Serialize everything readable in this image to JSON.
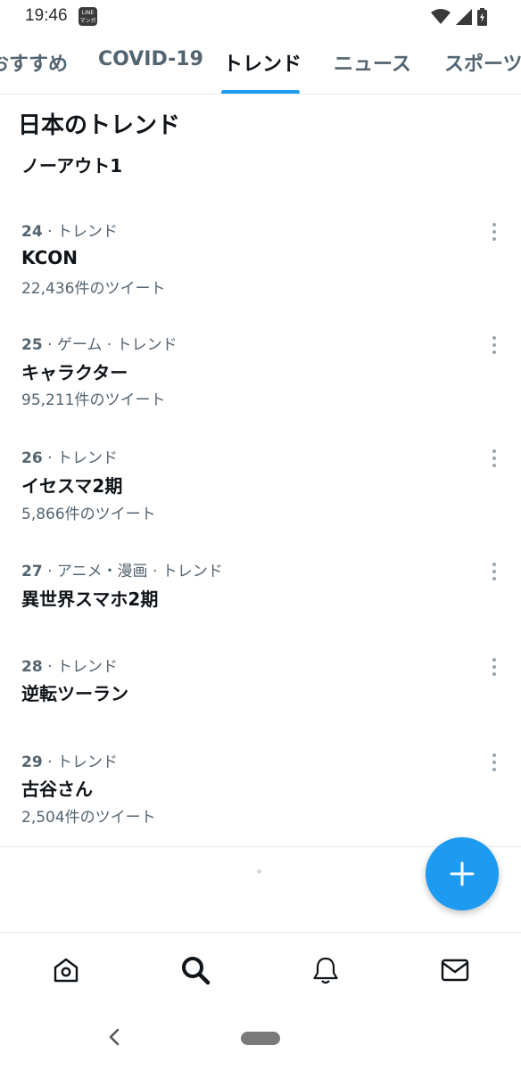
{
  "status_bar": {
    "time": "19:46",
    "app_badge": "LINE\nマンガ",
    "icons": [
      "wifi-icon",
      "cell-signal-icon",
      "battery-charging-icon"
    ]
  },
  "tabs": [
    {
      "label": "おすすめ",
      "active": false
    },
    {
      "label": "COVID-19",
      "active": false
    },
    {
      "label": "トレンド",
      "active": true
    },
    {
      "label": "ニュース",
      "active": false
    },
    {
      "label": "スポーツ",
      "active": false
    }
  ],
  "section_title": "日本のトレンド",
  "first_trend": "ノーアウト1",
  "trends": [
    {
      "rank": "24",
      "category": "· トレンド",
      "name": "KCON",
      "count": "22,436件のツイート"
    },
    {
      "rank": "25",
      "category": "· ゲーム · トレンド",
      "name": "キャラクター",
      "count": "95,211件のツイート"
    },
    {
      "rank": "26",
      "category": "· トレンド",
      "name": "イセスマ2期",
      "count": "5,866件のツイート"
    },
    {
      "rank": "27",
      "category": "· アニメ・漫画 · トレンド",
      "name": "異世界スマホ2期",
      "count": ""
    },
    {
      "rank": "28",
      "category": "· トレンド",
      "name": "逆転ツーラン",
      "count": ""
    },
    {
      "rank": "29",
      "category": "· トレンド",
      "name": "古谷さん",
      "count": "2,504件のツイート"
    }
  ],
  "fab": {
    "icon": "plus-icon"
  },
  "bottom_nav": [
    {
      "icon": "home-icon"
    },
    {
      "icon": "search-icon"
    },
    {
      "icon": "bell-icon"
    },
    {
      "icon": "mail-icon"
    }
  ],
  "colors": {
    "accent": "#1d9bf0",
    "text": "#0f1419",
    "secondary": "#536471"
  }
}
